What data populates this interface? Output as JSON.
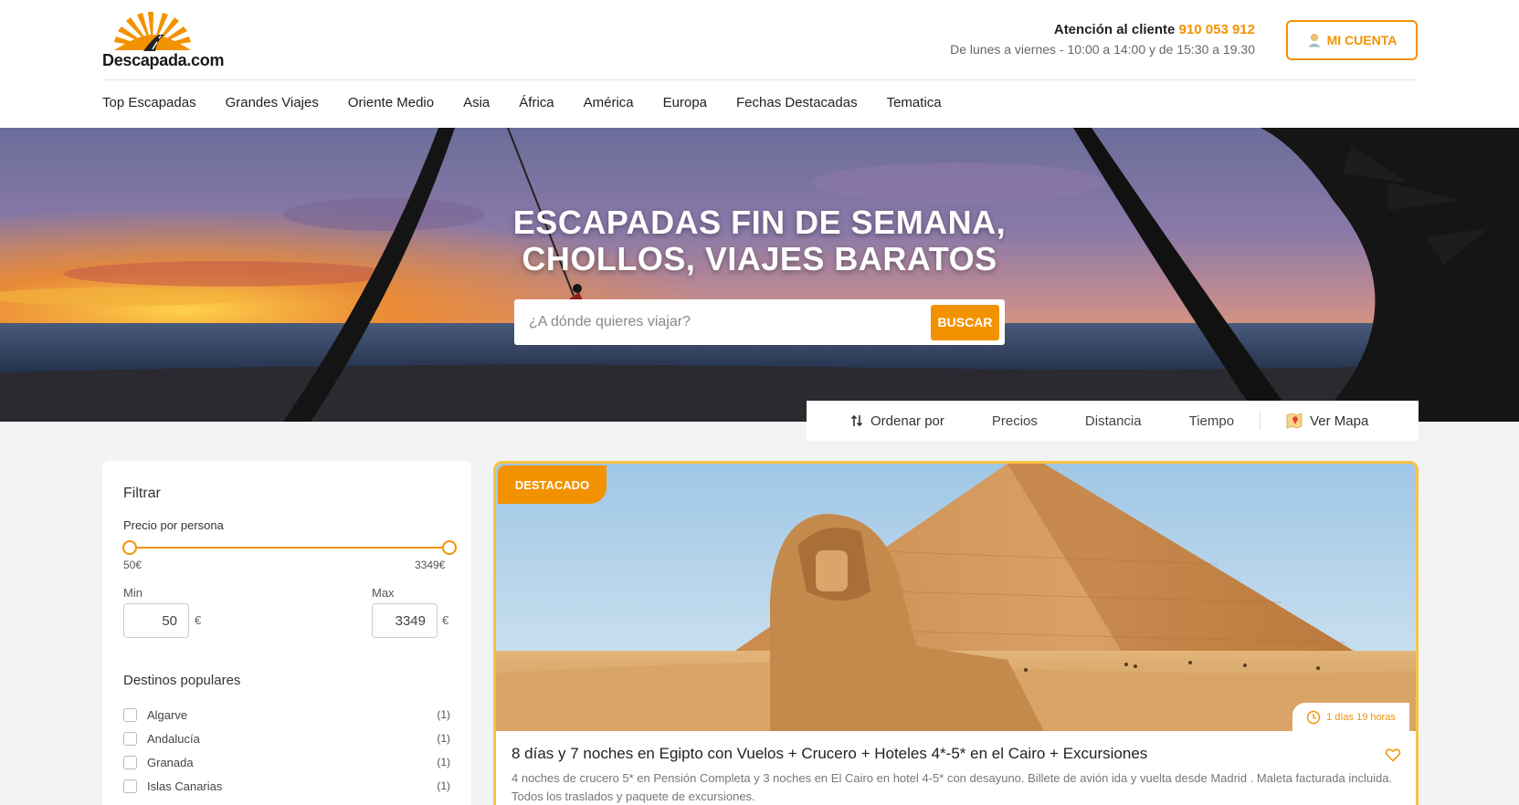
{
  "brand": {
    "logo_text": "Descapada.com",
    "accent": "#f39200"
  },
  "support": {
    "label": "Atención al cliente",
    "phone": "910 053 912",
    "hours": "De lunes a viernes - 10:00 a 14:00 y de 15:30 a 19.30"
  },
  "account": {
    "label": "MI CUENTA",
    "icon": "user-icon"
  },
  "nav": [
    "Top Escapadas",
    "Grandes Viajes",
    "Oriente Medio",
    "Asia",
    "África",
    "América",
    "Europa",
    "Fechas Destacadas",
    "Tematica"
  ],
  "hero": {
    "title_line1": "ESCAPADAS FIN DE SEMANA,",
    "title_line2": "CHOLLOS, VIAJES BARATOS",
    "search_placeholder": "¿A dónde quieres viajar?",
    "search_button": "BUSCAR"
  },
  "sort": {
    "label": "Ordenar por",
    "options": [
      "Precios",
      "Distancia",
      "Tiempo"
    ],
    "map_label": "Ver Mapa"
  },
  "filter": {
    "title": "Filtrar",
    "price_label": "Precio por persona",
    "range_min_label": "50€",
    "range_max_label": "3349€",
    "min_label": "Min",
    "max_label": "Max",
    "min_value": "50",
    "max_value": "3349",
    "currency": "€",
    "destinations_title": "Destinos populares",
    "destinations": [
      {
        "name": "Algarve",
        "count": "(1)"
      },
      {
        "name": "Andalucía",
        "count": "(1)"
      },
      {
        "name": "Granada",
        "count": "(1)"
      },
      {
        "name": "Islas Canarias",
        "count": "(1)"
      }
    ]
  },
  "card": {
    "badge": "DESTACADO",
    "duration": "1 días 19 horas",
    "title": "8 días y 7 noches en Egipto con Vuelos + Crucero + Hoteles 4*-5* en el Cairo + Excursiones",
    "description": "4 noches de crucero 5* en Pensión Completa  y  3 noches en El Cairo en hotel  4-5* con desayuno. Billete de avión  ida y vuelta desde Madrid . Maleta facturada incluida.  Todos los traslados y paquete de excursiones."
  }
}
